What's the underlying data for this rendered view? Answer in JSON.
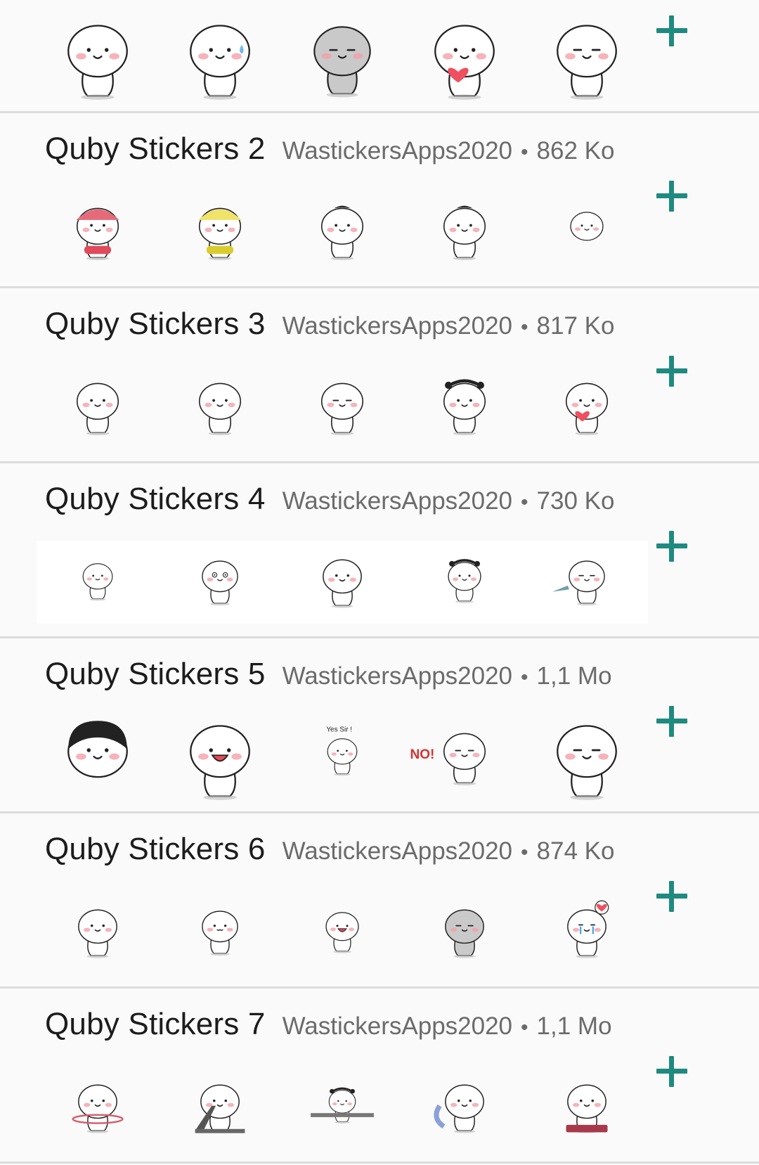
{
  "packs": [
    {
      "title": "",
      "author": "",
      "size": "",
      "stickers": [
        "quby-hands-together",
        "quby-sweat-drop",
        "quby-lying-sad",
        "quby-heart-blush",
        "quby-shy-wave"
      ]
    },
    {
      "title": "Quby Stickers 2",
      "author": "WastickersApps2020",
      "separator": "•",
      "size": "862 Ko",
      "stickers": [
        "quby-pink-scooter",
        "quby-yellow-scooter",
        "quby-lean",
        "quby-dance",
        "quby-lying"
      ]
    },
    {
      "title": "Quby Stickers 3",
      "author": "WastickersApps2020",
      "separator": "•",
      "size": "817 Ko",
      "stickers": [
        "quby-point",
        "quby-bag",
        "quby-peek",
        "quby-pigtails",
        "quby-heart-hold"
      ]
    },
    {
      "title": "Quby Stickers 4",
      "author": "WastickersApps2020",
      "separator": "•",
      "size": "730 Ko",
      "stickers": [
        "quby-small",
        "quby-surprised",
        "quby-mic",
        "quby-flower-crown",
        "quby-knife"
      ]
    },
    {
      "title": "Quby Stickers 5",
      "author": "WastickersApps2020",
      "separator": "•",
      "size": "1,1 Mo",
      "stickers": [
        "quby-black-hair",
        "quby-laugh",
        "quby-yes-sir",
        "quby-no-megaphone",
        "quby-shy-big"
      ],
      "sticker_texts": {
        "yes_sir": "Yes Sir !",
        "no": "NO!"
      }
    },
    {
      "title": "Quby Stickers 6",
      "author": "WastickersApps2020",
      "separator": "•",
      "size": "874 Ko",
      "stickers": [
        "quby-walk",
        "quby-arms-crossed",
        "quby-shh",
        "quby-lying-grey",
        "quby-crying-broken-heart"
      ]
    },
    {
      "title": "Quby Stickers 7",
      "author": "WastickersApps2020",
      "separator": "•",
      "size": "1,1 Mo",
      "stickers": [
        "quby-hula-hoop",
        "quby-treadmill",
        "quby-plank",
        "quby-noodles",
        "quby-scale"
      ]
    }
  ],
  "add_icon": "plus-icon",
  "colors": {
    "accent": "#1f8a7f",
    "blush": "#f4a0a8",
    "heart": "#ef4f5f"
  }
}
